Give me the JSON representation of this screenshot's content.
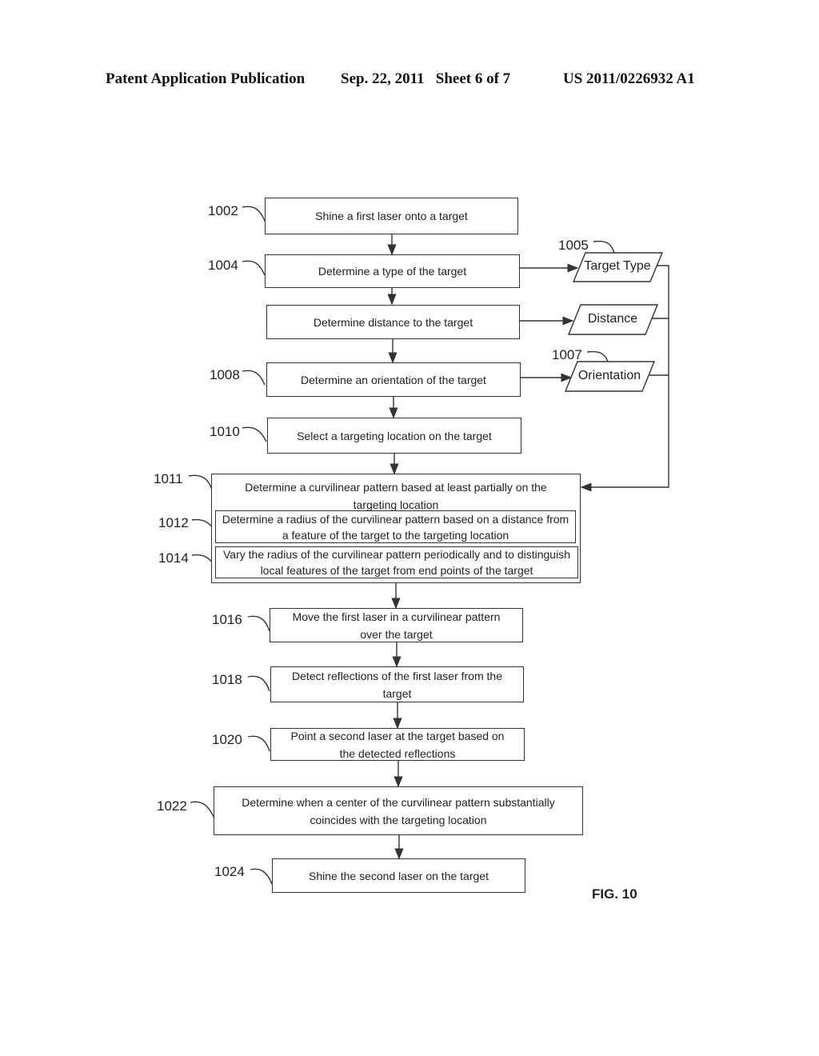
{
  "header": {
    "publication": "Patent Application Publication",
    "date_sheet": "Sep. 22, 2011   Sheet 6 of 7",
    "number": "US 2011/0226932 A1"
  },
  "figure_label": "FIG. 10",
  "steps": {
    "s1002": {
      "ref": "1002",
      "text": "Shine a first laser onto a target"
    },
    "s1004": {
      "ref": "1004",
      "text": "Determine a type of the target"
    },
    "s1006": {
      "text": "Determine distance to the target"
    },
    "s1008": {
      "ref": "1008",
      "text": "Determine an orientation of the target"
    },
    "s1010": {
      "ref": "1010",
      "text": "Select a targeting location on the target"
    },
    "s1011": {
      "ref": "1011",
      "text": "Determine a curvilinear pattern based at least partially on the targeting location"
    },
    "s1012": {
      "ref": "1012",
      "text": "Determine a radius of the curvilinear pattern based on a distance from a feature of the target to the targeting location"
    },
    "s1014": {
      "ref": "1014",
      "text": "Vary the radius of the curvilinear pattern periodically and to distinguish local features of the target from end points of the target"
    },
    "s1016": {
      "ref": "1016",
      "text": "Move the first laser in a curvilinear pattern over the target"
    },
    "s1018": {
      "ref": "1018",
      "text": "Detect reflections of the first laser from the target"
    },
    "s1020": {
      "ref": "1020",
      "text": "Point a second laser at the target based on the detected reflections"
    },
    "s1022": {
      "ref": "1022",
      "text": "Determine when a center of the curvilinear pattern substantially coincides with the targeting location"
    },
    "s1024": {
      "ref": "1024",
      "text": "Shine the second laser on the target"
    }
  },
  "data_outputs": {
    "target_type": {
      "ref": "1005",
      "text": "Target Type"
    },
    "distance": {
      "text": "Distance"
    },
    "orientation": {
      "ref": "1007",
      "text": "Orientation"
    }
  }
}
